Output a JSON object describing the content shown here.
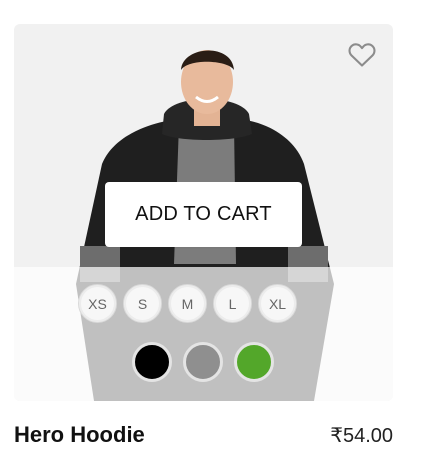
{
  "product": {
    "name": "Hero Hoodie",
    "price": "₹54.00",
    "image_alt": "Man wearing a black hoodie over a grey t-shirt"
  },
  "wishlist": {
    "icon": "heart-outline-icon"
  },
  "actions": {
    "add_to_cart_label": "ADD TO CART"
  },
  "sizes": [
    "XS",
    "S",
    "M",
    "L",
    "XL"
  ],
  "colors": [
    {
      "name": "Black",
      "hex": "#000000"
    },
    {
      "name": "Gray",
      "hex": "#8f8f8f"
    },
    {
      "name": "Green",
      "hex": "#53a72a"
    }
  ]
}
